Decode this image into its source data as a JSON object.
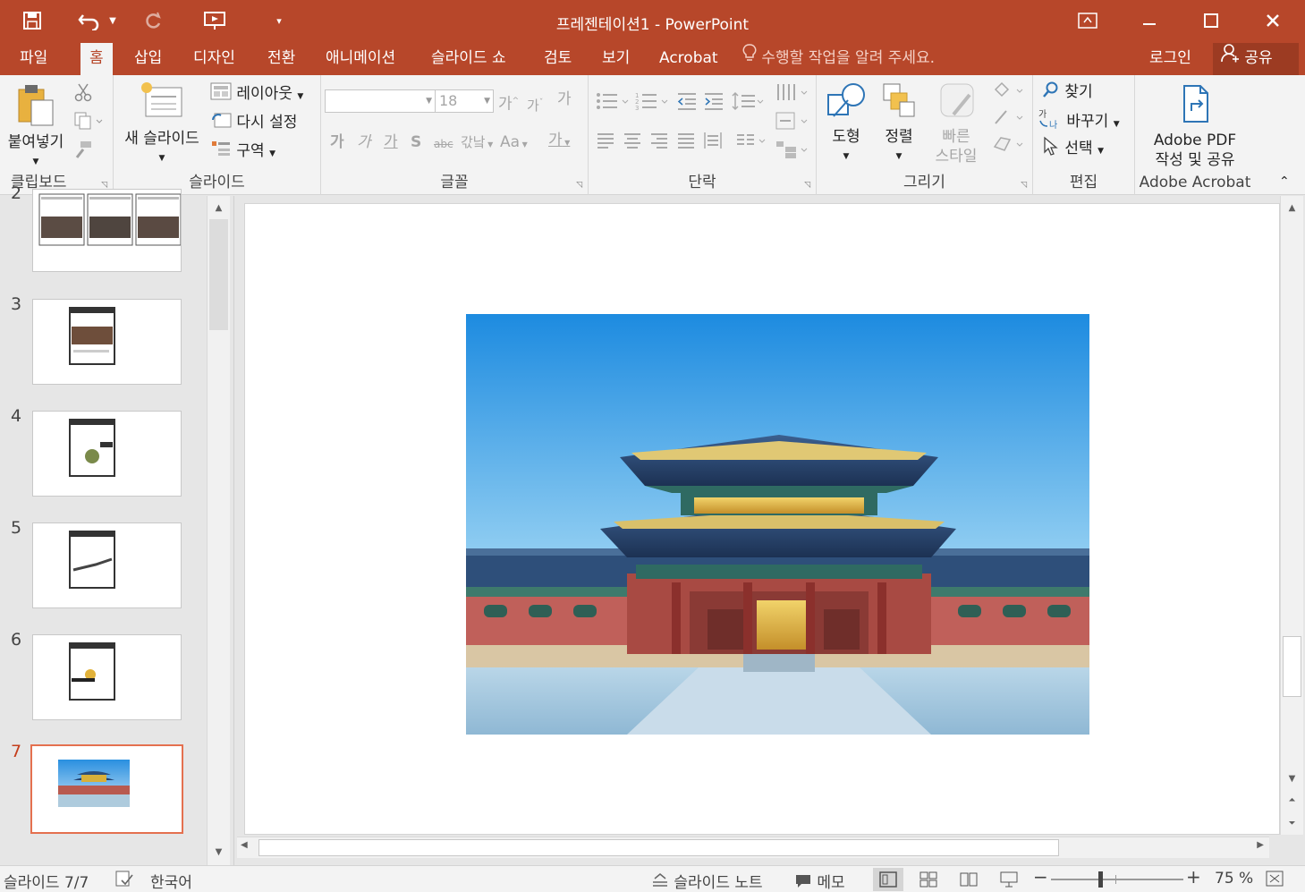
{
  "app": {
    "title": "프레젠테이션1 - PowerPoint"
  },
  "quick_access": {
    "save_icon": "save-icon",
    "undo_icon": "undo-icon",
    "redo_icon": "redo-icon",
    "present_icon": "start-from-beginning-icon",
    "customize_icon": "customize-toolbar-icon"
  },
  "window_controls": {
    "ribbon_display": "ribbon-display-options-icon",
    "minimize": "minimize-icon",
    "maximize": "maximize-icon",
    "close": "close-icon"
  },
  "menu": {
    "tabs": [
      "파일",
      "홈",
      "삽입",
      "디자인",
      "전환",
      "애니메이션",
      "슬라이드 쇼",
      "검토",
      "보기",
      "Acrobat"
    ],
    "active_tab": "홈",
    "tell_me": "수행할 작업을 알려 주세요.",
    "sign_in": "로그인",
    "share": "공유"
  },
  "ribbon": {
    "clipboard": {
      "label": "클립보드",
      "paste": "붙여넣기"
    },
    "slides": {
      "label": "슬라이드",
      "new_slide": "새 슬라이드",
      "layout": "레이아웃",
      "reset": "다시 설정",
      "section": "구역"
    },
    "font": {
      "label": "글꼴",
      "font_name": "",
      "font_size": "18",
      "grow": "가",
      "shrink": "가",
      "clear": "가",
      "bold": "가",
      "italic": "가",
      "underline": "가",
      "shadow": "S",
      "strike": "abc",
      "spacing": "갃낰",
      "case": "Aa",
      "color": "가"
    },
    "paragraph": {
      "label": "단락"
    },
    "drawing": {
      "label": "그리기",
      "shapes": "도형",
      "arrange": "정렬",
      "quick_styles_line1": "빠른",
      "quick_styles_line2": "스타일"
    },
    "editing": {
      "label": "편집",
      "find": "찾기",
      "replace": "바꾸기",
      "select": "선택"
    },
    "acrobat": {
      "label": "Adobe Acrobat",
      "create_line1": "Adobe PDF",
      "create_line2": "작성 및 공유"
    }
  },
  "thumbnails": [
    {
      "number": "2",
      "active": false
    },
    {
      "number": "3",
      "active": false
    },
    {
      "number": "4",
      "active": false
    },
    {
      "number": "5",
      "active": false
    },
    {
      "number": "6",
      "active": false
    },
    {
      "number": "7",
      "active": true
    }
  ],
  "status": {
    "slide_counter": "슬라이드 7/7",
    "language": "한국어",
    "notes": "슬라이드 노트",
    "comments": "메모",
    "zoom": "75 %",
    "zoom_level": 0.75
  },
  "colors": {
    "accent": "#b7472a",
    "accent_dark": "#9c3b22",
    "ribbon_bg": "#f3f3f3",
    "active_thumb_border": "#e4704f"
  }
}
